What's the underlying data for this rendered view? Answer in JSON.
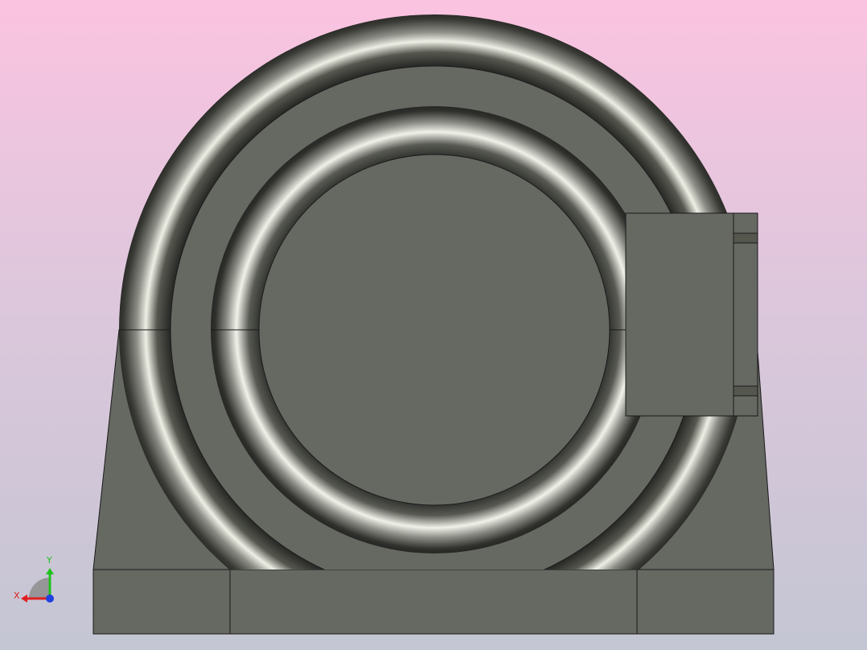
{
  "viewport": {
    "background_top": "#fbc3e0",
    "background_bottom": "#c4c6d3",
    "model_face_color": "#666862",
    "edge_color": "#1a1a1a"
  },
  "triad": {
    "x_label": "X",
    "y_label": "Y",
    "x_color": "#e02020",
    "y_color": "#20c020",
    "z_color": "#2040e0"
  }
}
